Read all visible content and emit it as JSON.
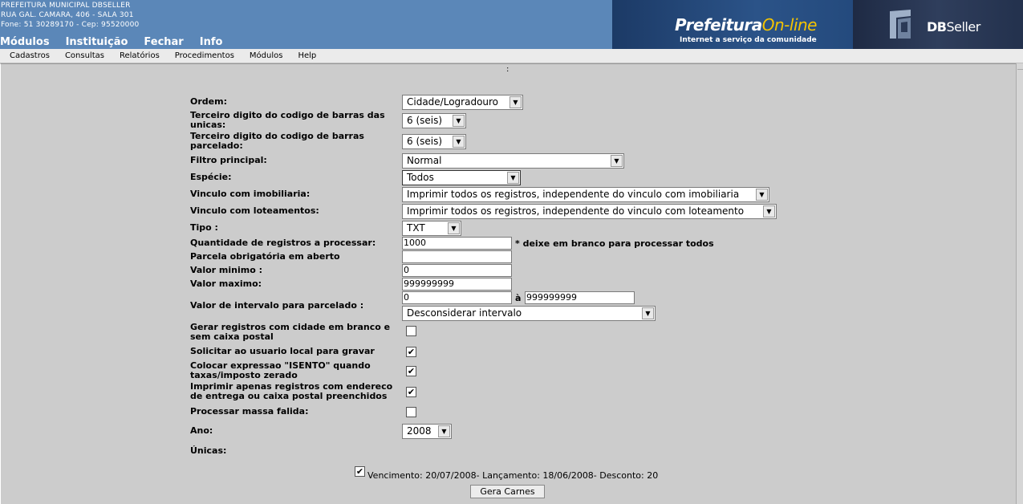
{
  "header": {
    "addr_line1": "PREFEITURA MUNICIPAL DBSELLER",
    "addr_line2": "RUA GAL. CAMARA, 406 - SALA 301",
    "addr_line3": "Fone: 51 30289170  -  Cep: 95520000",
    "top_menu": [
      "Módulos",
      "Instituição",
      "Fechar",
      "Info"
    ],
    "banner_title": "Prefeitura",
    "banner_title_online": "On-line",
    "banner_sub": "Internet a serviço da comunidade",
    "brand_db": "DB",
    "brand_seller": "Seller"
  },
  "menubar": [
    "Cadastros",
    "Consultas",
    "Relatórios",
    "Procedimentos",
    "Módulos",
    "Help"
  ],
  "colon": ":",
  "form": {
    "ordem_label": "Ordem:",
    "ordem_value": "Cidade/Logradouro",
    "terceiro_unicas_label": "Terceiro digito do codigo de barras das unicas:",
    "terceiro_unicas_value": "6 (seis)",
    "terceiro_parcelado_label": "Terceiro digito do codigo de barras parcelado:",
    "terceiro_parcelado_value": "6 (seis)",
    "filtro_label": "Filtro principal:",
    "filtro_value": "Normal",
    "especie_label": "Espécie:",
    "especie_value": "Todos",
    "vinc_imob_label": "Vinculo com imobiliaria:",
    "vinc_imob_value": "Imprimir todos os registros, independente do vinculo com imobiliaria",
    "vinc_lote_label": "Vinculo com loteamentos:",
    "vinc_lote_value": "Imprimir todos os registros, independente do vinculo com loteamento",
    "tipo_label": "Tipo :",
    "tipo_value": "TXT",
    "qtd_label": "Quantidade de registros a processar:",
    "qtd_value": "1000",
    "qtd_note": "* deixe em branco para processar todos",
    "parcela_label": "Parcela obrigatória em aberto",
    "parcela_value": "",
    "vmin_label": "Valor minimo :",
    "vmin_value": "0",
    "vmax_label": "Valor maximo:",
    "vmax_value": "999999999",
    "intervalo_label": "Valor de intervalo para parcelado :",
    "intervalo_from": "0",
    "intervalo_sep": "à",
    "intervalo_to": "999999999",
    "intervalo_select": "Desconsiderar intervalo",
    "cidade_branco_label": "Gerar registros com cidade em branco e sem caixa postal",
    "solicitar_label": "Solicitar ao usuario local para gravar",
    "isento_label": "Colocar expressao \"ISENTO\" quando taxas/imposto zerado",
    "imprimir_label": "Imprimir apenas registros com endereco de entrega ou caixa postal preenchidos",
    "massa_label": "Processar massa falida:",
    "ano_label": "Ano:",
    "ano_value": "2008",
    "unicas_label": "Únicas:",
    "check_mark": "✔",
    "unica_text": "Vencimento: 20/07/2008- Lançamento: 18/06/2008- Desconto: 20",
    "button": "Gera Carnes"
  }
}
